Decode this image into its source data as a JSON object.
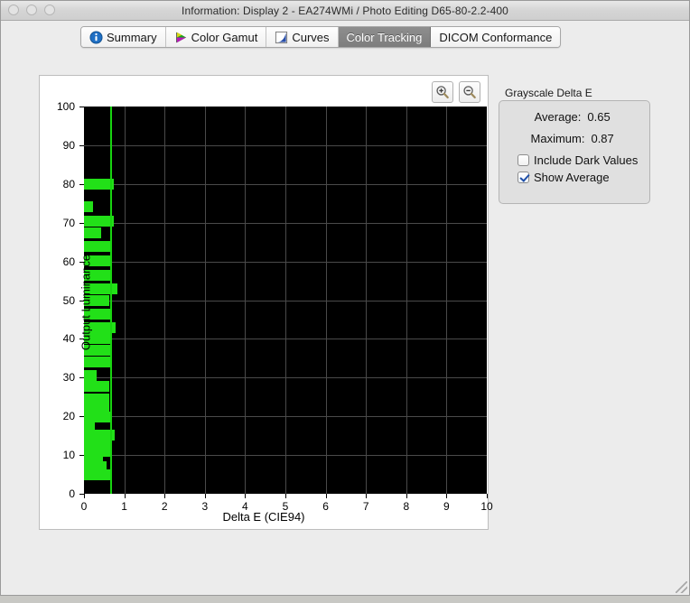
{
  "window": {
    "title": "Information: Display 2 - EA274WMi / Photo Editing D65-80-2.2-400",
    "traffic_lights": [
      "close-button",
      "minimize-button",
      "zoom-button"
    ]
  },
  "tabs": [
    {
      "label": "Summary",
      "icon": "info-icon",
      "active": false
    },
    {
      "label": "Color Gamut",
      "icon": "color-gamut-icon",
      "active": false
    },
    {
      "label": "Curves",
      "icon": "curves-icon",
      "active": false
    },
    {
      "label": "Color Tracking",
      "icon": "",
      "active": true
    },
    {
      "label": "DICOM Conformance",
      "icon": "",
      "active": false
    }
  ],
  "chart_toolbar": {
    "zoom_in_label": "+",
    "zoom_out_label": "−"
  },
  "panel": {
    "title": "Grayscale Delta E",
    "stats": [
      {
        "label": "Average:",
        "value": "0.65"
      },
      {
        "label": "Maximum:",
        "value": "0.87"
      }
    ],
    "checkboxes": [
      {
        "label": "Include Dark Values",
        "checked": false
      },
      {
        "label": "Show Average",
        "checked": true
      }
    ]
  },
  "colors": {
    "bar": "#22e018",
    "average_line": "#18d410",
    "plot_background": "#000000",
    "grid": "#4a4a4a",
    "active_tab": "#8e8e8e"
  },
  "chart_data": {
    "type": "bar",
    "orientation": "horizontal",
    "title": "",
    "xlabel": "Delta E (CIE94)",
    "ylabel": "Output Luminance",
    "xlim": [
      0,
      10
    ],
    "ylim": [
      0,
      100
    ],
    "xticks": [
      0,
      1,
      2,
      3,
      4,
      5,
      6,
      7,
      8,
      9,
      10
    ],
    "yticks": [
      0,
      10,
      20,
      30,
      40,
      50,
      60,
      70,
      80,
      90,
      100
    ],
    "grid": true,
    "legend": false,
    "average_line_value": 0.65,
    "maximum_value": 0.87,
    "categories": [
      80.0,
      74.2,
      70.5,
      67.3,
      63.8,
      60.2,
      56.5,
      53.0,
      50.0,
      46.5,
      43.0,
      40.0,
      37.0,
      34.0,
      30.5,
      27.8,
      24.5,
      22.0,
      19.8,
      17.5,
      15.2,
      13.0,
      11.0,
      9.0,
      7.0,
      5.0
    ],
    "values": [
      0.73,
      0.23,
      0.73,
      0.42,
      0.7,
      0.64,
      0.68,
      0.84,
      0.62,
      0.7,
      0.78,
      0.64,
      0.64,
      0.68,
      0.32,
      0.63,
      0.62,
      0.62,
      0.66,
      0.26,
      0.76,
      0.68,
      0.7,
      0.47,
      0.55,
      0.7
    ]
  }
}
